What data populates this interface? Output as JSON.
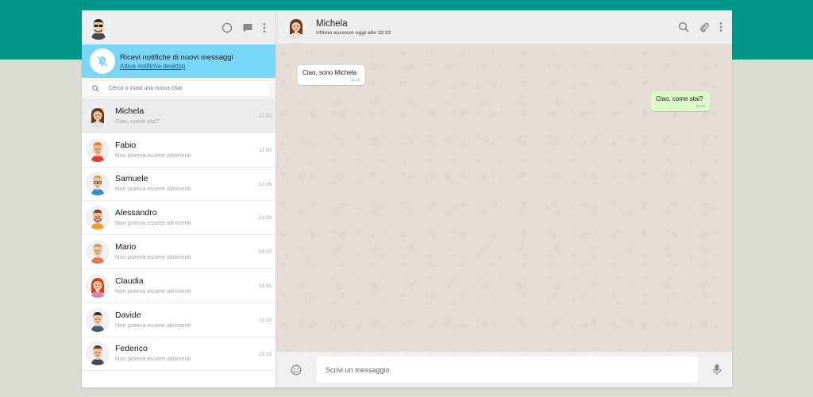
{
  "sidebar": {
    "notification": {
      "title": "Ricevi notifiche di nuovi messaggi",
      "link": "Attiva notifiche desktop"
    },
    "search": {
      "placeholder": "Cerca o inizia una nuova chat"
    },
    "chats": [
      {
        "name": "Michela",
        "preview": "Ciao, come stai?",
        "time": "12:33",
        "active": true
      },
      {
        "name": "Fabio",
        "preview": "Non poteva essere altrimenti",
        "time": "11:00"
      },
      {
        "name": "Samuele",
        "preview": "Non poteva essere altrimenti",
        "time": "12:06"
      },
      {
        "name": "Alessandro",
        "preview": "Non poteva essere altrimenti",
        "time": "23:28"
      },
      {
        "name": "Mario",
        "preview": "Non poteva essere altrimenti",
        "time": "09:10"
      },
      {
        "name": "Claudia",
        "preview": "Non poteva essere altrimenti",
        "time": "18:55"
      },
      {
        "name": "Davide",
        "preview": "Non poteva essere altrimenti",
        "time": "11:10"
      },
      {
        "name": "Federico",
        "preview": "Non poteva essere altrimenti",
        "time": "15:23"
      }
    ]
  },
  "conversation": {
    "contact_name": "Michela",
    "status": "Ultimo accesso oggi alle 12:33",
    "messages": [
      {
        "direction": "in",
        "text": "Ciao, sono Michela",
        "time": "11:15"
      },
      {
        "direction": "out",
        "text": "Ciao, come stai?",
        "time": "12:36"
      }
    ]
  },
  "composer": {
    "placeholder": "Scrivi un messaggio"
  },
  "icons": {
    "status": "status-circle-icon",
    "new_chat": "chat-bubble-icon",
    "menu": "vertical-dots-icon",
    "notification": "bell-off-icon",
    "search": "search-icon",
    "attach": "paperclip-icon",
    "emoji": "emoji-icon",
    "mic": "microphone-icon"
  },
  "colors": {
    "header_band": "#009688",
    "notification_bg": "#7ad6f7",
    "outgoing_bubble": "#dcf8c6",
    "conversation_bg": "#e5ddd5"
  }
}
